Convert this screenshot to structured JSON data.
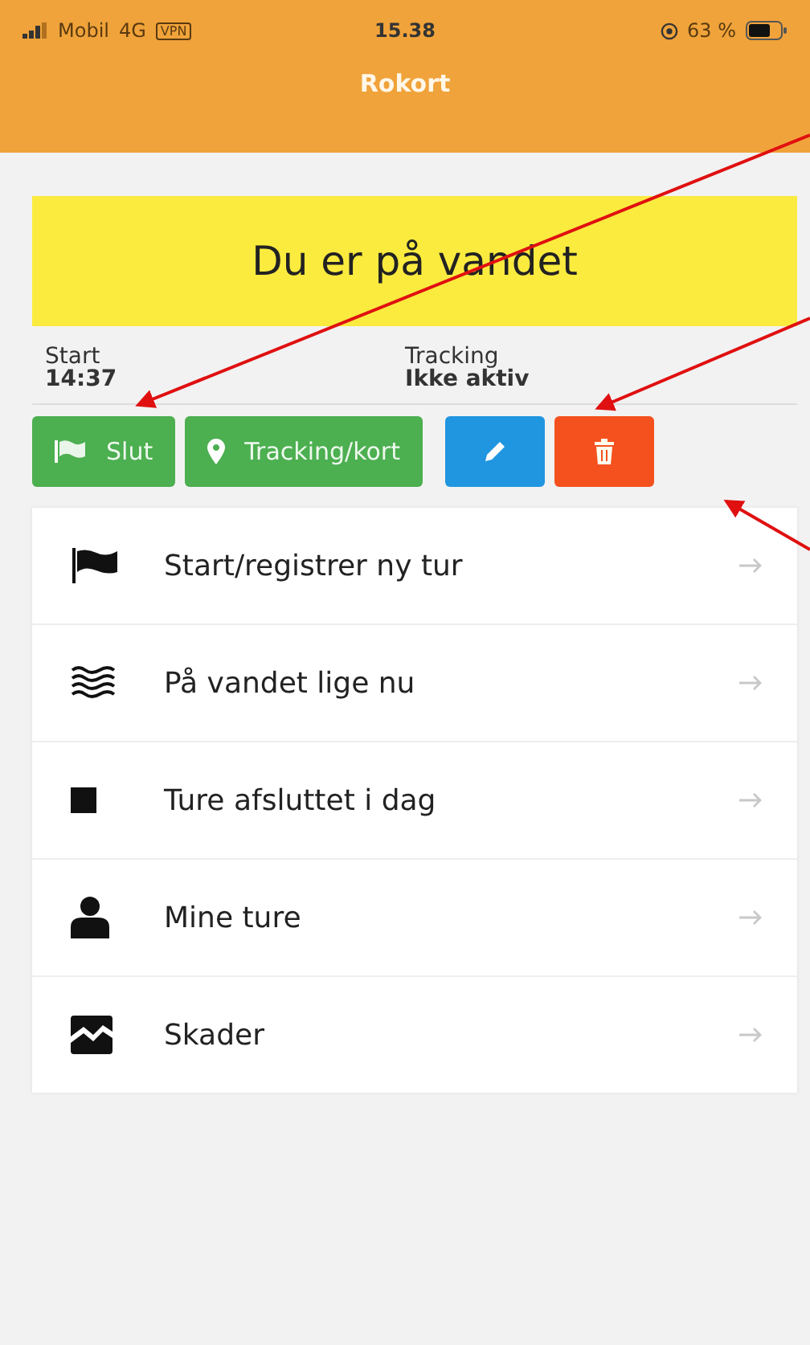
{
  "status_bar": {
    "carrier": "Mobil",
    "network": "4G",
    "vpn": "VPN",
    "time": "15.38",
    "battery": "63 %"
  },
  "header": {
    "title": "Rokort"
  },
  "banner": {
    "text": "Du er på vandet"
  },
  "info": [
    {
      "label": "Start",
      "value": "14:37"
    },
    {
      "label": "Tracking",
      "value": "Ikke aktiv"
    }
  ],
  "actions": [
    {
      "kind": "end",
      "label": "Slut"
    },
    {
      "kind": "tracking",
      "label": "Tracking/kort"
    },
    {
      "kind": "edit"
    },
    {
      "kind": "delete"
    }
  ],
  "menu": [
    {
      "kind": "flag",
      "label": "Start/registrer ny tur"
    },
    {
      "kind": "waves",
      "label": "På vandet lige nu"
    },
    {
      "kind": "square",
      "label": "Ture afsluttet i dag"
    },
    {
      "kind": "person",
      "label": "Mine ture"
    },
    {
      "kind": "damage",
      "label": "Skader"
    }
  ]
}
